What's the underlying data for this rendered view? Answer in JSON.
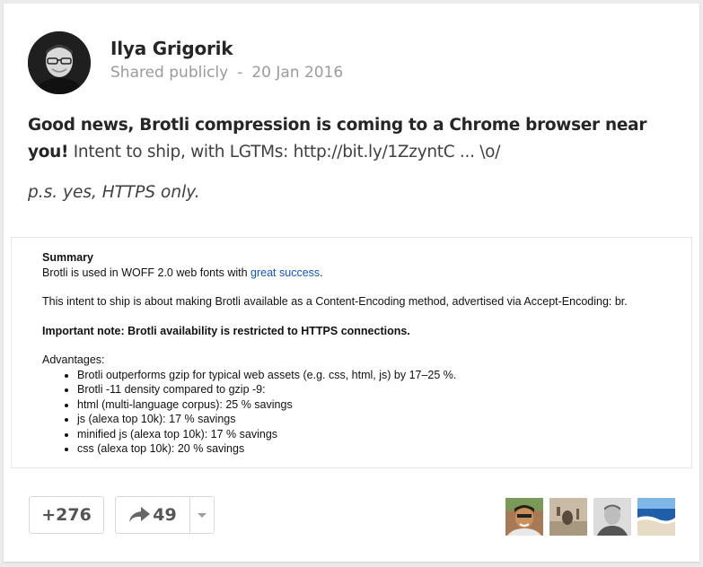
{
  "post": {
    "author": "Ilya Grigorik",
    "visibility": "Shared publicly",
    "separator": "-",
    "date": "20 Jan 2016",
    "text_bold": "Good news, Brotli compression is coming to a Chrome browser near you!",
    "text_rest": " Intent to ship, with LGTMs: http://bit.ly/1ZzyntC ... \\o/",
    "ps": "p.s. yes, HTTPS only."
  },
  "attachment": {
    "summary_title": "Summary",
    "woff_text": "Brotli is used in WOFF 2.0 web fonts with ",
    "woff_link": "great success",
    "woff_end": ".",
    "intent_text": "This intent to ship is about making Brotli available as a Content-Encoding method, advertised via Accept-Encoding: br.",
    "important_note": "Important note: Brotli availability is restricted to HTTPS connections.",
    "advantages_title": "Advantages:",
    "advantages": [
      "Brotli outperforms gzip for typical web assets (e.g. css, html, js) by 17–25 %.",
      "Brotli -11 density compared to gzip -9:",
      "html (multi-language corpus): 25 % savings",
      "js (alexa top 10k): 17 % savings",
      "minified js (alexa top 10k): 17 % savings",
      "css (alexa top 10k): 20 % savings"
    ]
  },
  "actions": {
    "plus_count": "+276",
    "share_count": "49",
    "share_icon": "share-arrow-icon",
    "more_icon": "chevron-down-icon"
  },
  "colors": {
    "author": "#262626",
    "meta": "#9b9b9b",
    "link": "#1155cc",
    "border": "#d9d9d9"
  }
}
